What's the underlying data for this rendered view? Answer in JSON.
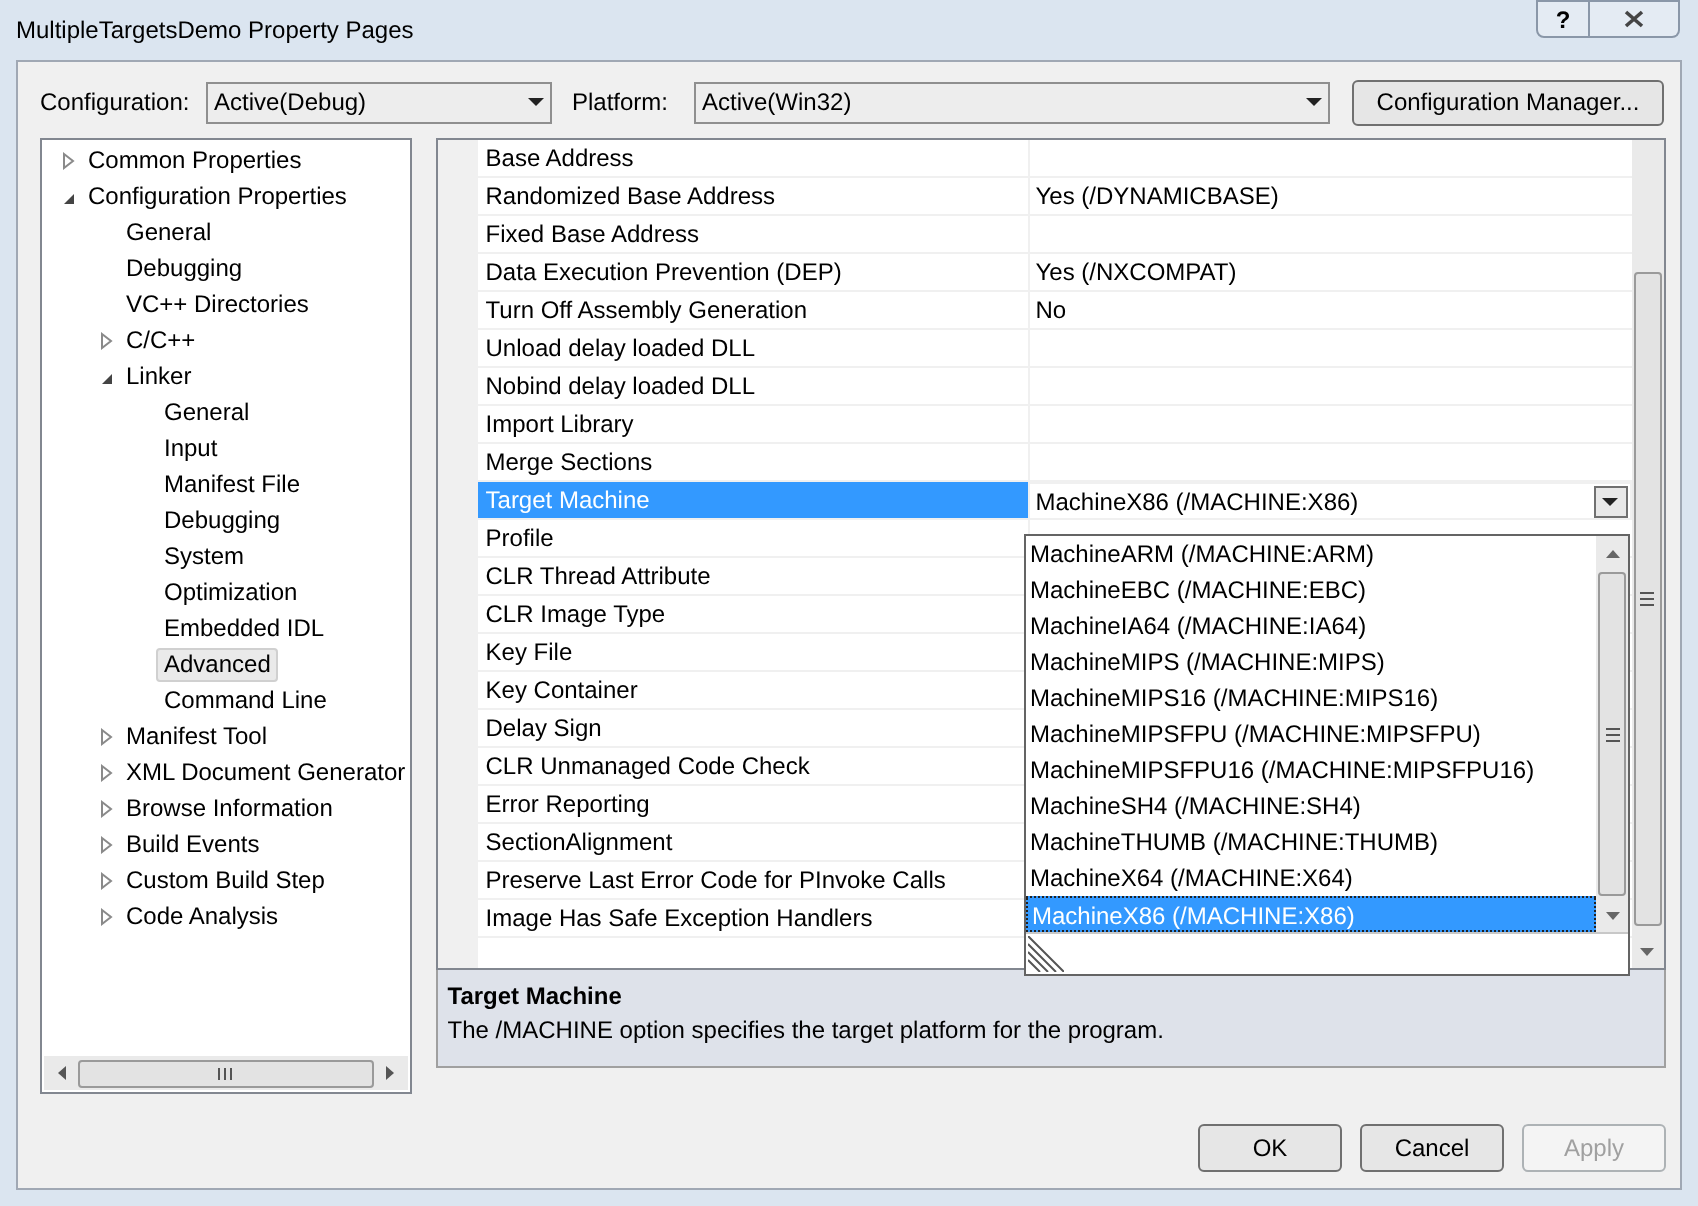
{
  "window": {
    "title": "MultipleTargetsDemo Property Pages",
    "help_button": "?"
  },
  "toolbar": {
    "configuration_label": "Configuration:",
    "configuration": "Active(Debug)",
    "platform_label": "Platform:",
    "platform": "Active(Win32)",
    "manager_button": "Configuration Manager..."
  },
  "tree": [
    {
      "label": "Common Properties",
      "expanded": false,
      "selected": false
    },
    {
      "label": "Configuration Properties",
      "expanded": true,
      "selected": false,
      "children": [
        {
          "label": "General",
          "selected": false
        },
        {
          "label": "Debugging",
          "selected": false
        },
        {
          "label": "VC++ Directories",
          "selected": false
        },
        {
          "label": "C/C++",
          "expanded": false,
          "selected": false
        },
        {
          "label": "Linker",
          "expanded": true,
          "selected": false,
          "children": [
            {
              "label": "General",
              "selected": false
            },
            {
              "label": "Input",
              "selected": false
            },
            {
              "label": "Manifest File",
              "selected": false
            },
            {
              "label": "Debugging",
              "selected": false
            },
            {
              "label": "System",
              "selected": false
            },
            {
              "label": "Optimization",
              "selected": false
            },
            {
              "label": "Embedded IDL",
              "selected": false
            },
            {
              "label": "Advanced",
              "selected": true
            },
            {
              "label": "Command Line",
              "selected": false
            }
          ]
        },
        {
          "label": "Manifest Tool",
          "expanded": false,
          "selected": false
        },
        {
          "label": "XML Document Generator",
          "expanded": false,
          "selected": false
        },
        {
          "label": "Browse Information",
          "expanded": false,
          "selected": false
        },
        {
          "label": "Build Events",
          "expanded": false,
          "selected": false
        },
        {
          "label": "Custom Build Step",
          "expanded": false,
          "selected": false
        },
        {
          "label": "Code Analysis",
          "expanded": false,
          "selected": false
        }
      ]
    }
  ],
  "properties": [
    {
      "name": "Base Address",
      "selected": false
    },
    {
      "name": "Randomized Base Address",
      "value": "Yes (/DYNAMICBASE)",
      "selected": false
    },
    {
      "name": "Fixed Base Address",
      "selected": false
    },
    {
      "name": "Data Execution Prevention (DEP)",
      "value": "Yes (/NXCOMPAT)",
      "selected": false
    },
    {
      "name": "Turn Off Assembly Generation",
      "value": "No",
      "selected": false
    },
    {
      "name": "Unload delay loaded DLL",
      "selected": false
    },
    {
      "name": "Nobind delay loaded DLL",
      "selected": false
    },
    {
      "name": "Import Library",
      "selected": false
    },
    {
      "name": "Merge Sections",
      "selected": false
    },
    {
      "name": "Target Machine",
      "value": "MachineX86 (/MACHINE:X86)",
      "selected": true
    },
    {
      "name": "Profile",
      "selected": false
    },
    {
      "name": "CLR Thread Attribute",
      "selected": false
    },
    {
      "name": "CLR Image Type",
      "selected": false
    },
    {
      "name": "Key File",
      "selected": false
    },
    {
      "name": "Key Container",
      "selected": false
    },
    {
      "name": "Delay Sign",
      "selected": false
    },
    {
      "name": "CLR Unmanaged Code Check",
      "selected": false
    },
    {
      "name": "Error Reporting",
      "selected": false
    },
    {
      "name": "SectionAlignment",
      "selected": false
    },
    {
      "name": "Preserve Last Error Code for PInvoke Calls",
      "selected": false
    },
    {
      "name": "Image Has Safe Exception Handlers",
      "selected": false
    }
  ],
  "dropdown_options": [
    {
      "label": "MachineARM (/MACHINE:ARM)",
      "selected": false
    },
    {
      "label": "MachineEBC (/MACHINE:EBC)",
      "selected": false
    },
    {
      "label": "MachineIA64 (/MACHINE:IA64)",
      "selected": false
    },
    {
      "label": "MachineMIPS (/MACHINE:MIPS)",
      "selected": false
    },
    {
      "label": "MachineMIPS16 (/MACHINE:MIPS16)",
      "selected": false
    },
    {
      "label": "MachineMIPSFPU (/MACHINE:MIPSFPU)",
      "selected": false
    },
    {
      "label": "MachineMIPSFPU16 (/MACHINE:MIPSFPU16)",
      "selected": false
    },
    {
      "label": "MachineSH4 (/MACHINE:SH4)",
      "selected": false
    },
    {
      "label": "MachineTHUMB (/MACHINE:THUMB)",
      "selected": false
    },
    {
      "label": "MachineX64 (/MACHINE:X64)",
      "selected": false
    },
    {
      "label": "MachineX86 (/MACHINE:X86)",
      "selected": true
    }
  ],
  "description": {
    "title": "Target Machine",
    "text": "The /MACHINE option specifies the target platform for the program."
  },
  "buttons": [
    {
      "label": "OK",
      "disabled": false
    },
    {
      "label": "Cancel",
      "disabled": false
    },
    {
      "label": "Apply",
      "disabled": true
    }
  ]
}
